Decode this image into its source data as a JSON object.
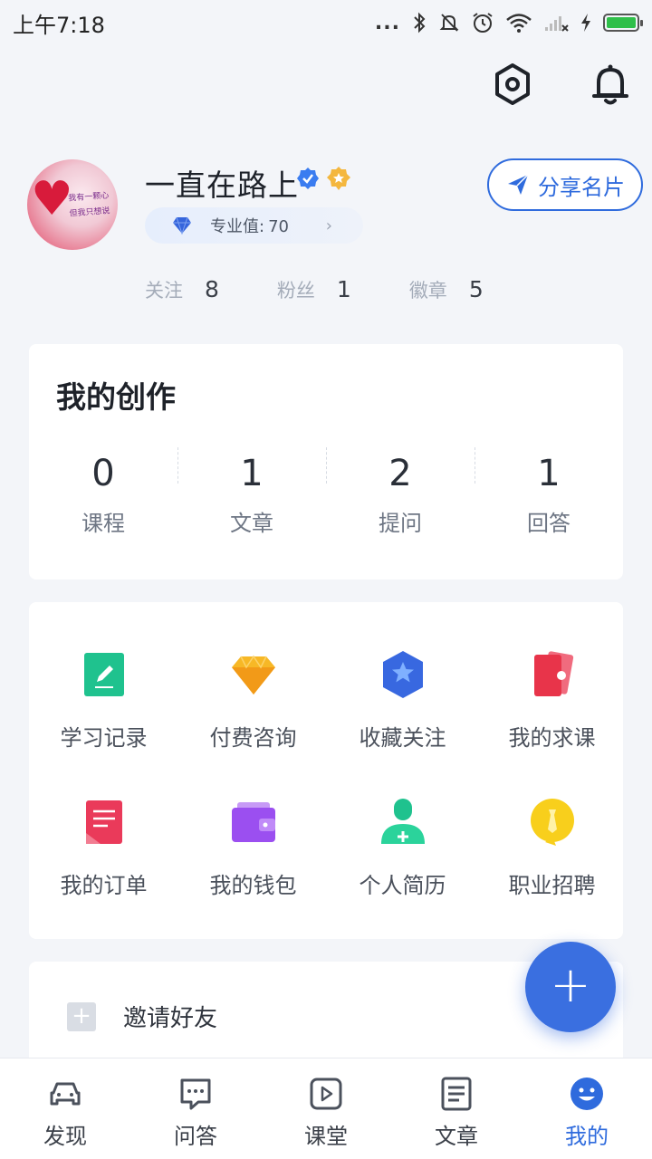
{
  "status_bar": {
    "time": "上午7:18",
    "dots": "...",
    "battery_level": 1.0
  },
  "profile": {
    "username": "一直在路上",
    "pro_label": "专业值:",
    "pro_value": "70",
    "share_label": "分享名片",
    "avatar_text_line1": "我有一颗心",
    "avatar_text_line2": "但我只想说"
  },
  "stats": [
    {
      "label": "关注",
      "value": "8"
    },
    {
      "label": "粉丝",
      "value": "1"
    },
    {
      "label": "徽章",
      "value": "5"
    }
  ],
  "creation": {
    "title": "我的创作",
    "items": [
      {
        "label": "课程",
        "value": "0"
      },
      {
        "label": "文章",
        "value": "1"
      },
      {
        "label": "提问",
        "value": "2"
      },
      {
        "label": "回答",
        "value": "1"
      }
    ]
  },
  "tools": [
    {
      "label": "学习记录",
      "icon": "learning-record-icon"
    },
    {
      "label": "付费咨询",
      "icon": "paid-consult-icon"
    },
    {
      "label": "收藏关注",
      "icon": "favorites-icon"
    },
    {
      "label": "我的求课",
      "icon": "course-request-icon"
    },
    {
      "label": "我的订单",
      "icon": "orders-icon"
    },
    {
      "label": "我的钱包",
      "icon": "wallet-icon"
    },
    {
      "label": "个人简历",
      "icon": "resume-icon"
    },
    {
      "label": "职业招聘",
      "icon": "recruit-icon"
    }
  ],
  "invite": {
    "label": "邀请好友",
    "plus": "+"
  },
  "fab": {
    "label": "+"
  },
  "nav": [
    {
      "label": "发现",
      "icon": "discover-icon"
    },
    {
      "label": "问答",
      "icon": "qa-icon"
    },
    {
      "label": "课堂",
      "icon": "classroom-icon"
    },
    {
      "label": "文章",
      "icon": "article-icon"
    },
    {
      "label": "我的",
      "icon": "me-icon"
    }
  ],
  "colors": {
    "accent": "#2f6bdd",
    "fab": "#3a6fe0",
    "background": "#f3f5f9"
  }
}
